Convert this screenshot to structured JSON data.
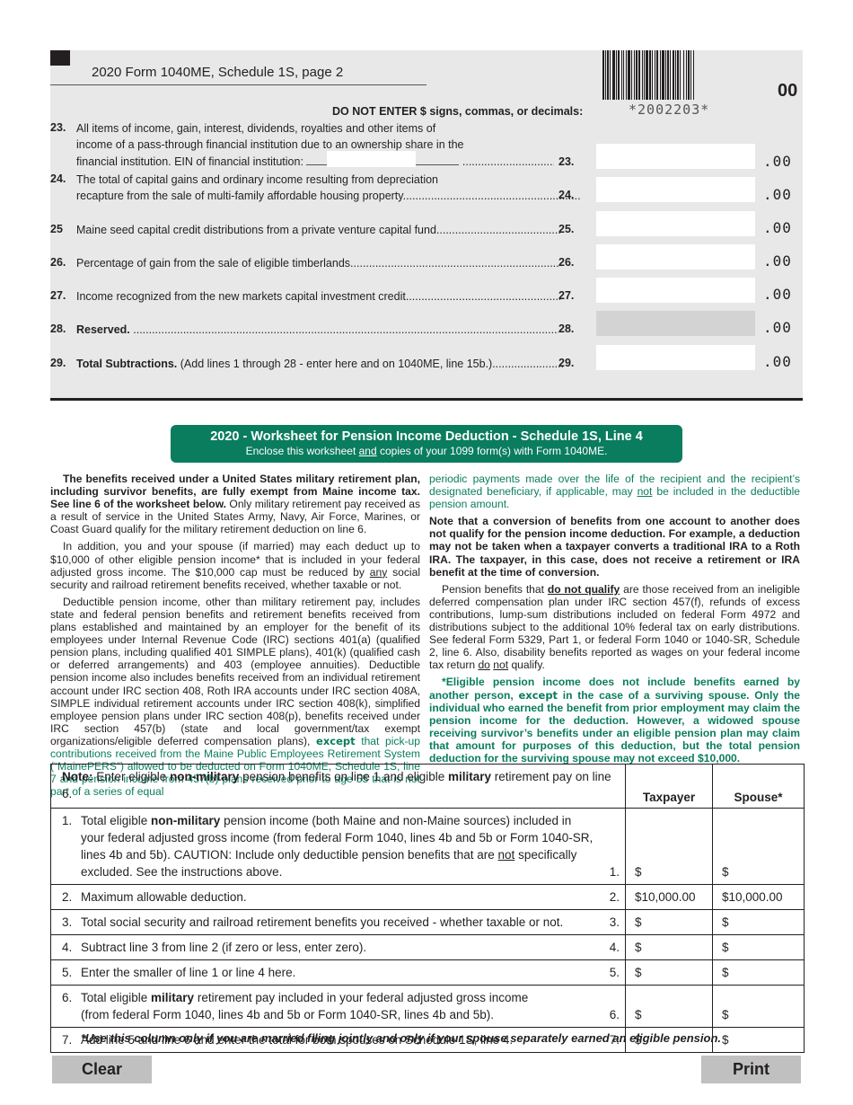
{
  "header": {
    "page_title": "2020 Form 1040ME, Schedule 1S, page 2",
    "barcode_text": "*2002203*",
    "form_code": "00",
    "instruction": "DO NOT ENTER $ signs, commas, or decimals:"
  },
  "lines": [
    {
      "num": "23.",
      "text_lines": [
        "All items of income, gain, interest, dividends, royalties and other items of",
        "income of a pass-through financial institution due to an ownership share in the",
        "financial institution. EIN of financial institution: "
      ],
      "ref": "23.",
      "value": "",
      "cents": ".00",
      "ein_value": ""
    },
    {
      "num": "24.",
      "text_lines": [
        "The total of capital gains and ordinary income resulting from depreciation",
        "recapture from the sale of multi-family affordable housing property."
      ],
      "ref": "24.",
      "value": "",
      "cents": ".00"
    },
    {
      "num": "25",
      "text": "Maine seed capital credit distributions from a private venture capital fund",
      "ref": "25.",
      "value": "",
      "cents": ".00"
    },
    {
      "num": "26.",
      "text": "Percentage of gain from the sale of eligible timberlands",
      "ref": "26.",
      "value": "",
      "cents": ".00"
    },
    {
      "num": "27.",
      "text": "Income recognized from the new markets capital investment credit",
      "ref": "27.",
      "value": "",
      "cents": ".00"
    },
    {
      "num": "28.",
      "text_bold": "Reserved.",
      "text": "",
      "ref": "28.",
      "value": "",
      "cents": ".00",
      "disabled": true
    },
    {
      "num": "29.",
      "text_bold": "Total Subtractions.",
      "text": " (Add lines 1 through 28 - enter here and on 1040ME, line 15b.)",
      "ref": "29.",
      "value": "",
      "cents": ".00"
    }
  ],
  "worksheet": {
    "title": "2020 - Worksheet for Pension Income Deduction - Schedule 1S, Line 4",
    "subtitle_pre": "Enclose this worksheet ",
    "subtitle_u": "and",
    "subtitle_post": " copies of your 1099 form(s) with Form 1040ME.",
    "left_col": {
      "p1_bold": "The benefits received under a United States military retirement plan, including survivor benefits, are fully exempt from Maine income tax. See line 6 of the worksheet below.",
      "p1_rest": " Only military retirement pay received as a result of service in the United States Army, Navy, Air Force, Marines, or Coast Guard qualify for the military retirement deduction on line 6.",
      "p2_a": "In addition, you and your spouse (if married) may each deduct up to $10,000 of other eligible pension income* that is included in your federal adjusted gross income. The $10,000 cap must be reduced by ",
      "p2_u": "any",
      "p2_b": " social security and railroad retirement benefits received, whether taxable or not.",
      "p3_a": "Deductible pension income, other than military retirement pay, includes state and federal pension benefits and retirement benefits received from plans established and maintained by an employer for the benefit of its employees under Internal Revenue Code (IRC) sections 401(a) (qualified pension plans, including qualified 401 SIMPLE plans), 401(k) (qualified cash or deferred arrangements) and 403 (employee annuities). Deductible pension income also includes benefits received from an individual retirement account under IRC section 408, Roth IRA accounts under IRC section 408A, SIMPLE individual retirement accounts under IRC section 408(k), simplified employee pension plans under IRC section 408(p), benefits received under IRC section 457(b) (state and local government/tax exempt organizations/eligible deferred compensation plans), ",
      "p3_except": "except",
      "p3_green": " that pick-up contributions received from the Maine Public Employees Retirement System (“MainePERS”) allowed to be deducted on Form 1040ME, Schedule 1S, line 7 and pension income from 457(b) plans received prior to age 55 that is not part of a series of equal"
    },
    "right_col": {
      "p1_green_a": "periodic payments made over the life of the recipient and the recipient’s designated beneficiary, if applicable, may ",
      "p1_green_u": "not",
      "p1_green_b": " be included in the deductible pension amount.",
      "p2_bold": "Note that a conversion of benefits from one account to another does not qualify for the pension income deduction. For example, a deduction may not be taken when a taxpayer converts a traditional IRA to a Roth IRA. The taxpayer, in this case, does not receive a retirement or IRA benefit at the time of conversion.",
      "p3_a": "Pension benefits that ",
      "p3_bu": "do not qualify",
      "p3_b": " are those received from an ineligible deferred compensation plan under IRC section 457(f), refunds of excess contributions, lump-sum distributions included on federal Form 4972 and distributions subject to the additional 10% federal tax on early distributions. See federal Form 5329, Part 1, or federal Form 1040 or 1040-SR, Schedule 2, line 6. Also, disability benefits reported as wages on your federal income tax return ",
      "p3_u1": "do",
      "p3_u2": "not",
      "p3_c": " qualify.",
      "p4_a": "*Eligible pension income does not include benefits earned by another person, ",
      "p4_except": "except",
      "p4_b": " in the case of a surviving spouse. Only the individual who earned the benefit from prior employment may claim the pension income for the deduction. However, a widowed spouse receiving survivor’s benefits under an eligible pension plan may claim that amount for purposes of this deduction, but the total pension deduction for the surviving spouse may not exceed $10,000."
    },
    "table": {
      "note_label": "Note:",
      "note_a": " Enter eligible ",
      "note_b1": "non-military",
      "note_c": " pension benefits on line 1 and eligible ",
      "note_b2": "military",
      "note_d": " retirement pay on line 6.",
      "col_taxpayer": "Taxpayer",
      "col_spouse": "Spouse*",
      "rows": [
        {
          "n": "1.",
          "pre": "Total eligible ",
          "bold": "non-military",
          "post": " pension income (both Maine and non-Maine sources) included in your federal adjusted gross income (from federal Form 1040, lines 4b and 5b or Form 1040-SR, lines 4b and 5b).  CAUTION: Include only deductible pension benefits that are ",
          "u": "not",
          "post2": " specifically excluded.  See the instructions above.",
          "ref": "1.",
          "taxpayer": "$",
          "spouse": "$"
        },
        {
          "n": "2.",
          "pre": "Maximum allowable deduction.",
          "ref": "2.",
          "taxpayer": "$10,000.00",
          "spouse": "$10,000.00"
        },
        {
          "n": "3.",
          "pre": "Total social security and railroad retirement benefits you received - whether taxable or not.",
          "ref": "3.",
          "taxpayer": "$",
          "spouse": "$"
        },
        {
          "n": "4.",
          "pre": "Subtract line 3 from line 2 (if zero or less, enter zero).",
          "ref": "4.",
          "taxpayer": "$",
          "spouse": "$"
        },
        {
          "n": "5.",
          "pre": "Enter the smaller of line 1 or line 4 here.",
          "ref": "5.",
          "taxpayer": "$",
          "spouse": "$"
        },
        {
          "n": "6.",
          "pre": "Total eligible ",
          "bold": "military",
          "post": " retirement pay included in your federal adjusted gross income",
          "line2": "(from federal Form 1040, lines 4b and 5b or Form 1040-SR, lines 4b and 5b).",
          "ref": "6.",
          "taxpayer": "$",
          "spouse": "$"
        },
        {
          "n": "7.",
          "pre": "Add line 5 and line 6 and enter the total for both spouses on Schedule 1S, line 4.",
          "ref": "7.",
          "taxpayer": "$",
          "spouse": "$"
        }
      ]
    },
    "footnote": "*Use this column only if you are married filing jointly and only if your spouse separately earned an eligible pension."
  },
  "buttons": {
    "clear": "Clear",
    "print": "Print"
  },
  "colors": {
    "accent_green": "#0a7d5e",
    "panel_gray": "#e8e8e8",
    "button_gray": "#c0c0c0"
  }
}
